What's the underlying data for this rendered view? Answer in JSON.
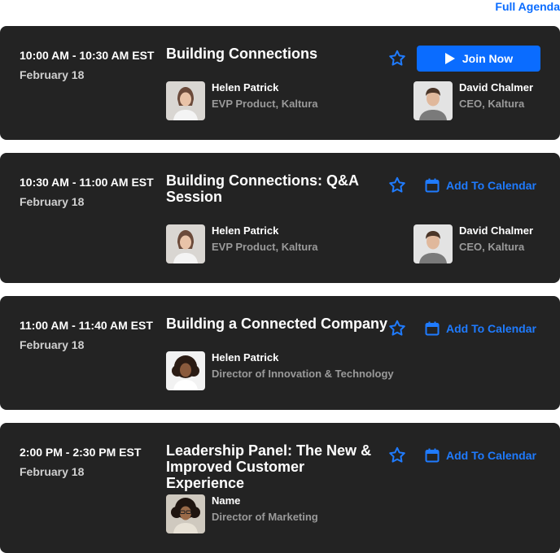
{
  "header": {
    "full_agenda_label": "Full Agenda"
  },
  "colors": {
    "accent": "#0a6cff",
    "card_bg": "#232323",
    "muted_text": "#9a9a9a"
  },
  "sessions": [
    {
      "time": "10:00 AM - 10:30 AM EST",
      "date": "February 18",
      "title": "Building Connections",
      "action": "Join Now",
      "action_icon": "play-icon",
      "speakers": [
        {
          "name": "Helen Patrick",
          "role": "EVP Product, Kaltura"
        },
        {
          "name": "David Chalmer",
          "role": "CEO, Kaltura"
        }
      ]
    },
    {
      "time": "10:30 AM - 11:00 AM EST",
      "date": "February 18",
      "title": "Building Connections: Q&A Session",
      "action": "Add To Calendar",
      "action_icon": "calendar-icon",
      "speakers": [
        {
          "name": "Helen Patrick",
          "role": "EVP Product, Kaltura"
        },
        {
          "name": "David Chalmer",
          "role": "CEO, Kaltura"
        }
      ]
    },
    {
      "time": "11:00 AM - 11:40 AM EST",
      "date": "February 18",
      "title": "Building a Connected Company",
      "action": "Add To Calendar",
      "action_icon": "calendar-icon",
      "speakers": [
        {
          "name": "Helen Patrick",
          "role": "Director of Innovation & Technology"
        }
      ]
    },
    {
      "time": "2:00 PM - 2:30 PM EST",
      "date": "February 18",
      "title": "Leadership Panel: The New & Improved Customer Experience",
      "action": "Add To Calendar",
      "action_icon": "calendar-icon",
      "speakers": [
        {
          "name": "Name",
          "role": "Director of Marketing"
        }
      ]
    }
  ]
}
